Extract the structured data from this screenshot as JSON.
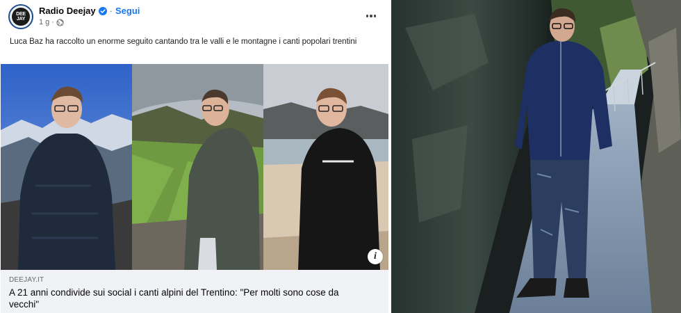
{
  "post": {
    "page_name": "Radio Deejay",
    "follow_label": "Segui",
    "separator": "·",
    "time": "1 g",
    "text": "Luca Baz ha raccolto un enorme seguito cantando tra le valli e le montagne i canti popolari trentini"
  },
  "avatar": {
    "logo_line1": "DEE",
    "logo_line2": "JAY"
  },
  "link_preview": {
    "domain": "DEEJAY.IT",
    "title": "A 21 anni condivide sui social i canti alpini del Trentino: \"Per molti sono cose da vecchi\""
  },
  "icons": {
    "verified": "verified-badge-icon",
    "privacy": "globe-icon",
    "more": "more-options-icon",
    "info": "info-icon"
  },
  "colors": {
    "facebook_blue": "#1877f2",
    "preview_background": "#f0f2f5"
  }
}
